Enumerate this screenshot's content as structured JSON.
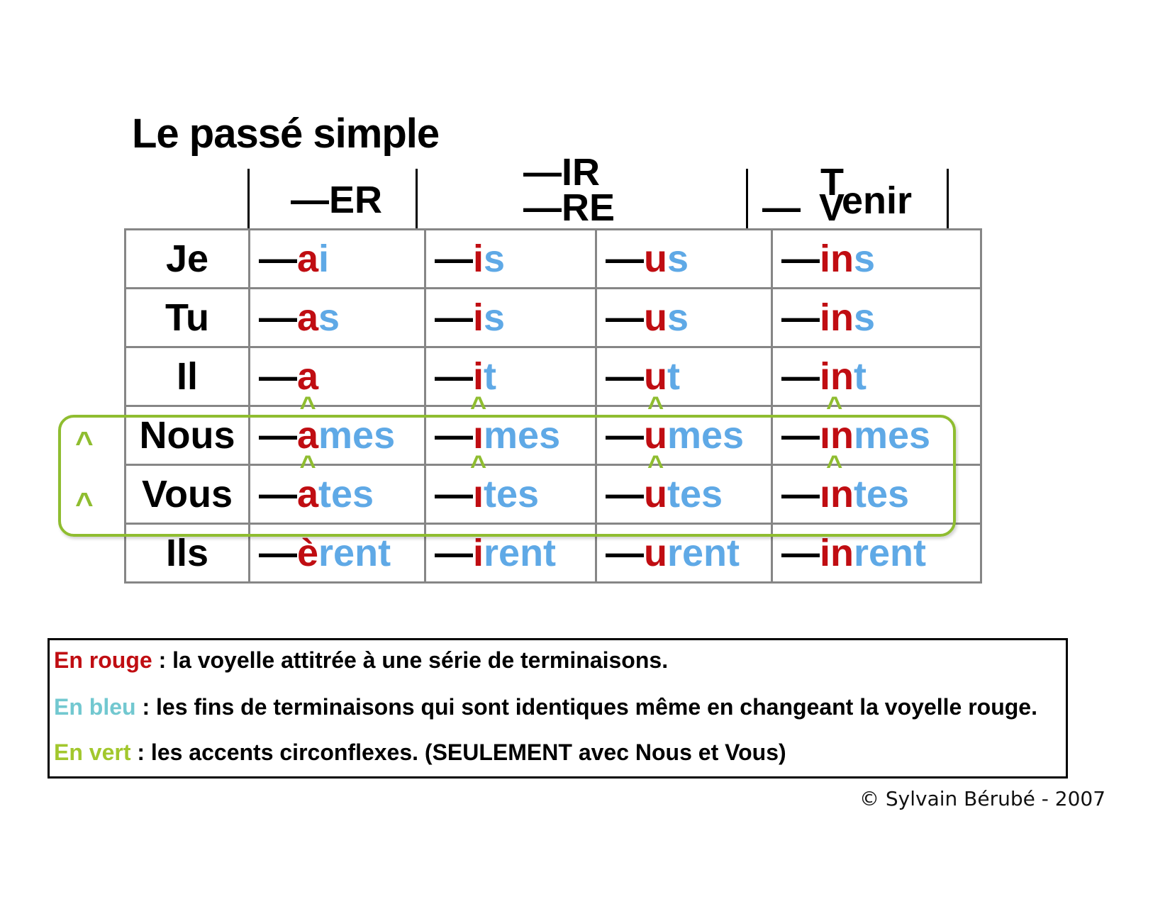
{
  "title": "Le passé simple",
  "headers": {
    "er": "—ER",
    "ir": "—IR",
    "re": "—RE",
    "tenir_venir": {
      "dash": "—",
      "t": "T",
      "v": "V",
      "rest": "enir"
    }
  },
  "colors": {
    "red": "#c00d12",
    "blue": "#5fa9e6",
    "green": "#8fbd30",
    "grid": "#868686"
  },
  "rows": [
    {
      "pronoun": "Je",
      "cells": [
        {
          "dash": "—",
          "red": "a",
          "blue": "i",
          "caret": ""
        },
        {
          "dash": "—",
          "red": "i",
          "blue": "s",
          "caret": ""
        },
        {
          "dash": "—",
          "red": "u",
          "blue": "s",
          "caret": ""
        },
        {
          "dash": "—",
          "red": "in",
          "blue": "s",
          "caret": ""
        }
      ]
    },
    {
      "pronoun": "Tu",
      "cells": [
        {
          "dash": "—",
          "red": "a",
          "blue": "s",
          "caret": ""
        },
        {
          "dash": "—",
          "red": "i",
          "blue": "s",
          "caret": ""
        },
        {
          "dash": "—",
          "red": "u",
          "blue": "s",
          "caret": ""
        },
        {
          "dash": "—",
          "red": "in",
          "blue": "s",
          "caret": ""
        }
      ]
    },
    {
      "pronoun": "Il",
      "cells": [
        {
          "dash": "—",
          "red": "a",
          "blue": "",
          "caret": ""
        },
        {
          "dash": "—",
          "red": "i",
          "blue": "t",
          "caret": ""
        },
        {
          "dash": "—",
          "red": "u",
          "blue": "t",
          "caret": ""
        },
        {
          "dash": "—",
          "red": "in",
          "blue": "t",
          "caret": ""
        }
      ]
    },
    {
      "pronoun": "Nous",
      "cells": [
        {
          "dash": "—",
          "red": "a",
          "blue": "mes",
          "caret": "^"
        },
        {
          "dash": "—",
          "red": "ı",
          "blue": "mes",
          "caret": "^"
        },
        {
          "dash": "—",
          "red": "u",
          "blue": "mes",
          "caret": "^"
        },
        {
          "dash": "—",
          "red": "ın",
          "blue": "mes",
          "caret": "^"
        }
      ]
    },
    {
      "pronoun": "Vous",
      "cells": [
        {
          "dash": "—",
          "red": "a",
          "blue": "tes",
          "caret": "^"
        },
        {
          "dash": "—",
          "red": "ı",
          "blue": "tes",
          "caret": "^"
        },
        {
          "dash": "—",
          "red": "u",
          "blue": "tes",
          "caret": "^"
        },
        {
          "dash": "—",
          "red": "ın",
          "blue": "tes",
          "caret": "^"
        }
      ]
    },
    {
      "pronoun": "Ils",
      "cells": [
        {
          "dash": "—",
          "red": "è",
          "blue": "rent",
          "caret": ""
        },
        {
          "dash": "—",
          "red": "i",
          "blue": "rent",
          "caret": ""
        },
        {
          "dash": "—",
          "red": "u",
          "blue": "rent",
          "caret": ""
        },
        {
          "dash": "—",
          "red": "in",
          "blue": "rent",
          "caret": ""
        }
      ]
    }
  ],
  "side_carets": [
    "^",
    "^"
  ],
  "legend": {
    "red": {
      "label": "En rouge",
      "text": " : la voyelle attitrée à une série de terminaisons."
    },
    "blue": {
      "label": "En bleu",
      "text": " : les fins de terminaisons qui sont identiques même en changeant la voyelle rouge."
    },
    "green": {
      "label": "En vert",
      "text": " : les accents circonflexes. (SEULEMENT avec Nous et Vous)"
    }
  },
  "copyright": "© Sylvain Bérubé - 2007"
}
